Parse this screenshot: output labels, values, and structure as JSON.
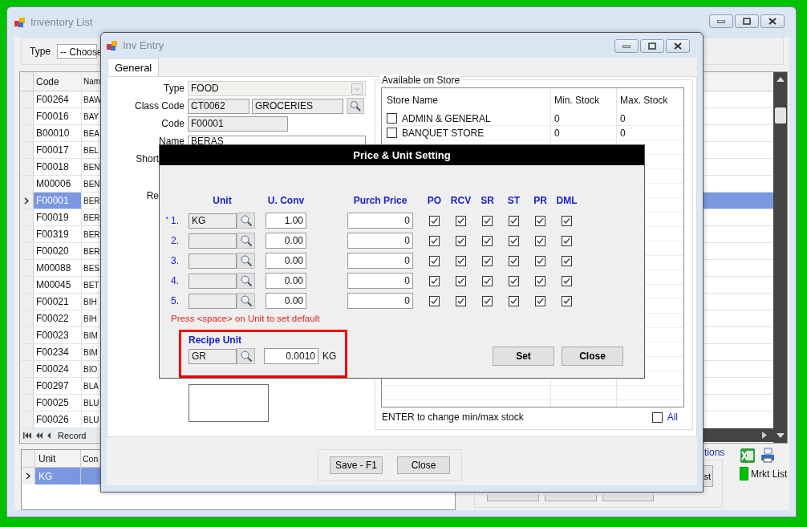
{
  "inventory_list": {
    "title": "Inventory List",
    "filter": {
      "label": "Type",
      "value": "-- Choose"
    },
    "grid": {
      "columns": [
        "Code",
        "Nam"
      ],
      "rows": [
        {
          "code": "F00264",
          "name": "BAW",
          "selected": false
        },
        {
          "code": "F00016",
          "name": "BAY",
          "selected": false
        },
        {
          "code": "B00010",
          "name": "BEA",
          "selected": false
        },
        {
          "code": "F00017",
          "name": "BEL",
          "selected": false
        },
        {
          "code": "F00018",
          "name": "BEN",
          "selected": false
        },
        {
          "code": "M00006",
          "name": "BEN",
          "selected": false
        },
        {
          "code": "F00001",
          "name": "BER",
          "selected": true
        },
        {
          "code": "F00019",
          "name": "BER",
          "selected": false
        },
        {
          "code": "F00319",
          "name": "BER",
          "selected": false
        },
        {
          "code": "F00020",
          "name": "BER",
          "selected": false
        },
        {
          "code": "M00088",
          "name": "BES",
          "selected": false
        },
        {
          "code": "M00045",
          "name": "BET",
          "selected": false
        },
        {
          "code": "F00021",
          "name": "BIH",
          "selected": false
        },
        {
          "code": "F00022",
          "name": "BIH",
          "selected": false
        },
        {
          "code": "F00023",
          "name": "BIM",
          "selected": false
        },
        {
          "code": "F00234",
          "name": "BIM",
          "selected": false
        },
        {
          "code": "F00024",
          "name": "BIO",
          "selected": false
        },
        {
          "code": "F00297",
          "name": "BLA",
          "selected": false
        },
        {
          "code": "F00025",
          "name": "BLU",
          "selected": false
        },
        {
          "code": "F00026",
          "name": "BLU",
          "selected": false
        }
      ],
      "navigator": "Record"
    },
    "unit_grid": {
      "columns": [
        "Unit",
        "Con"
      ],
      "rows": [
        {
          "unit": "KG",
          "selected": true
        }
      ]
    },
    "link": "tions",
    "partial_button": "st",
    "legend": "Mrkt List"
  },
  "inv_entry": {
    "title": "Inv Entry",
    "tabs": [
      {
        "label": "General",
        "selected": true
      }
    ],
    "labels": [
      "Type",
      "Class Code",
      "Code",
      "Name",
      "Short",
      "Re"
    ],
    "type": "FOOD",
    "class_code": "CT0062",
    "class_name": "GROCERIES",
    "code": "F00001",
    "name": "BERAS",
    "stores": {
      "title": "Available on Store",
      "columns": [
        "Store Name",
        "Min. Stock",
        "Max. Stock"
      ],
      "rows": [
        {
          "name": "ADMIN & GENERAL",
          "min": "0",
          "max": "0",
          "checked": false
        },
        {
          "name": "BANQUET STORE",
          "min": "0",
          "max": "0",
          "checked": false
        }
      ],
      "hint": "ENTER to change min/max stock",
      "all": {
        "label": "All",
        "checked": false
      }
    },
    "buttons": [
      "Save - F1",
      "Close"
    ]
  },
  "dialog": {
    "title": "Price & Unit Setting",
    "columns": [
      "Unit",
      "U. Conv",
      "Purch Price",
      "PO",
      "RCV",
      "SR",
      "ST",
      "PR",
      "DML"
    ],
    "rows": [
      {
        "marker": "*",
        "number": "1.",
        "unit": "KG",
        "conv": "1.00",
        "price": "0",
        "flags": [
          true,
          true,
          true,
          true,
          true,
          true
        ]
      },
      {
        "number": "2.",
        "conv": "0.00",
        "price": "0",
        "flags": [
          true,
          true,
          true,
          true,
          true,
          true
        ]
      },
      {
        "number": "3.",
        "conv": "0.00",
        "price": "0",
        "flags": [
          true,
          true,
          true,
          true,
          true,
          true
        ]
      },
      {
        "number": "4.",
        "conv": "0.00",
        "price": "0",
        "flags": [
          true,
          true,
          true,
          true,
          true,
          true
        ]
      },
      {
        "number": "5.",
        "conv": "0.00",
        "price": "0",
        "flags": [
          true,
          true,
          true,
          true,
          true,
          true
        ]
      }
    ],
    "hint": "Press <space> on Unit to set default",
    "recipe": {
      "label": "Recipe Unit",
      "unit": "GR",
      "factor": "0.0010",
      "base": "KG"
    },
    "buttons": [
      "Set",
      "Close"
    ]
  }
}
